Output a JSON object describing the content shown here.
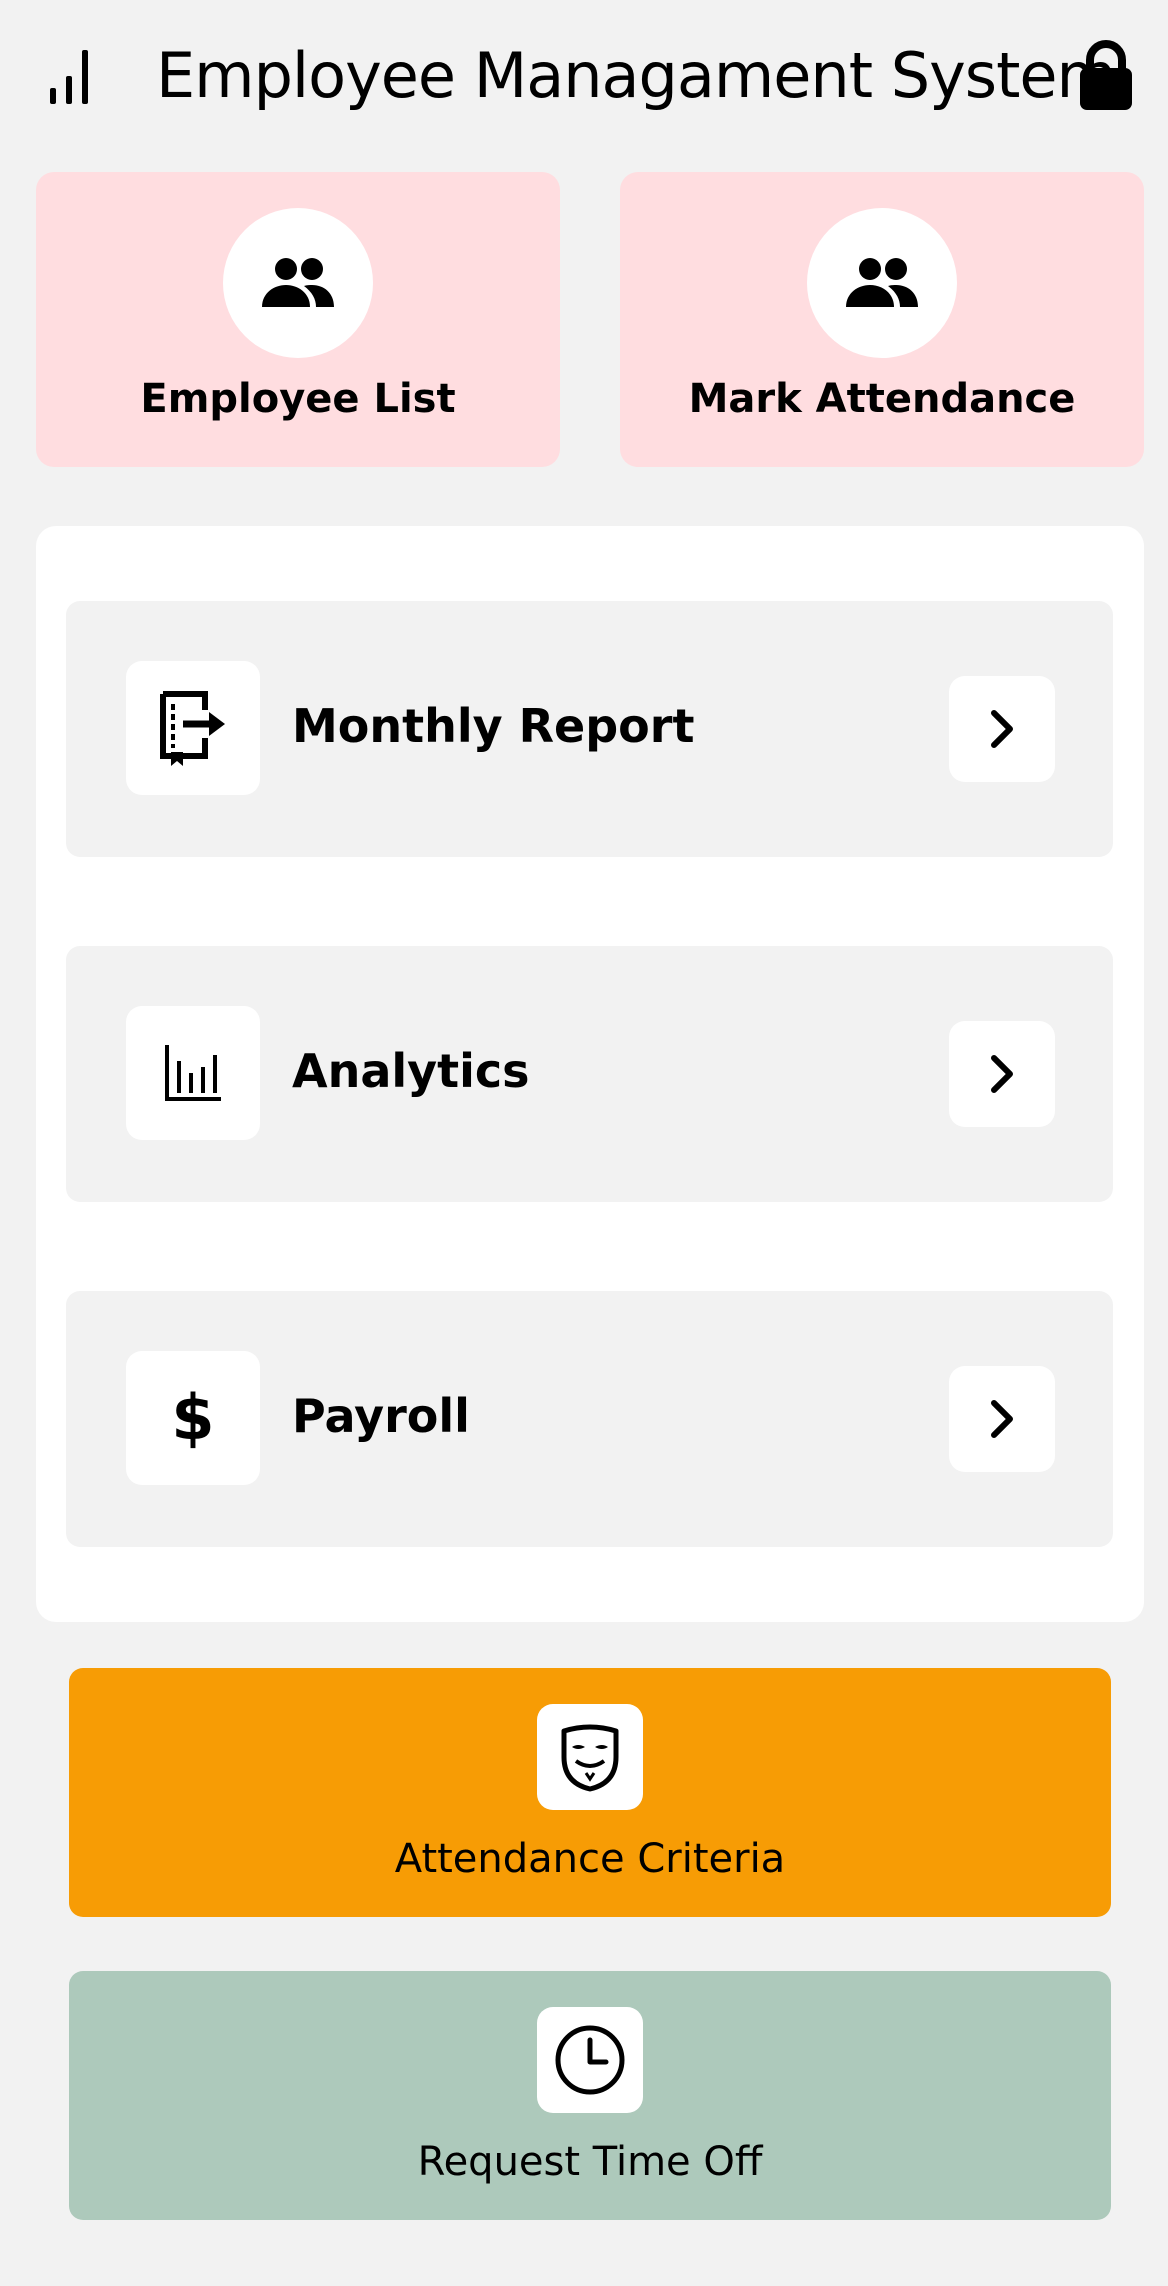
{
  "header": {
    "title": "Employee Managament System",
    "left_icon": "signal-bars-icon",
    "right_icon": "lock-icon"
  },
  "tiles": [
    {
      "label": "Employee List",
      "icon": "people-icon"
    },
    {
      "label": "Mark Attendance",
      "icon": "people-icon"
    }
  ],
  "menu": {
    "items": [
      {
        "label": "Monthly Report",
        "icon": "report-export-icon"
      },
      {
        "label": "Analytics",
        "icon": "bar-chart-icon"
      },
      {
        "label": "Payroll",
        "icon": "dollar-icon",
        "glyph": "$"
      }
    ]
  },
  "actions": [
    {
      "label": "Attendance Criteria",
      "icon": "mask-icon",
      "color": "#f79c05"
    },
    {
      "label": "Request Time Off",
      "icon": "clock-icon",
      "color": "#adc9bb"
    }
  ],
  "colors": {
    "background": "#f2f2f2",
    "tile": "#ffdde0",
    "card": "#ffffff",
    "row": "#f2f2f2"
  }
}
